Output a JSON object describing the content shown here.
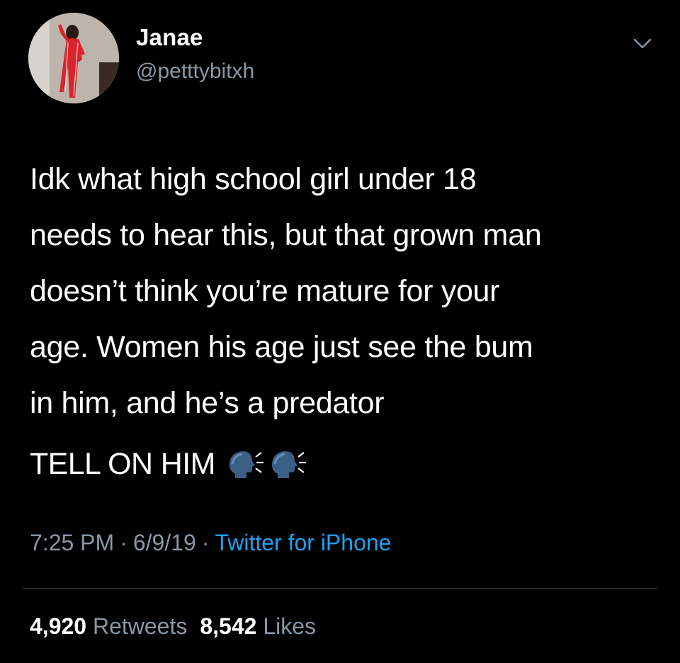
{
  "author": {
    "name": "Janae",
    "handle": "@petttybitxh"
  },
  "tweet": {
    "text": "Idk what high school girl under 18\nneeds to hear this, but that grown man\ndoesn’t think you’re mature for your\nage. Women his age just see the bum\nin him, and he’s a predator",
    "text_second": "TELL ON HIM",
    "emojis": [
      "speaking-head-emoji",
      "speaking-head-emoji"
    ]
  },
  "meta": {
    "time": "7:25 PM",
    "separator": "·",
    "date": "6/9/19",
    "source": "Twitter for iPhone"
  },
  "stats": {
    "retweets_count": "4,920",
    "retweets_label": "Retweets",
    "likes_count": "8,542",
    "likes_label": "Likes"
  },
  "colors": {
    "background": "#000000",
    "text": "#ffffff",
    "secondary": "#8899a6",
    "link": "#1da1f2",
    "divider": "#38444d"
  }
}
